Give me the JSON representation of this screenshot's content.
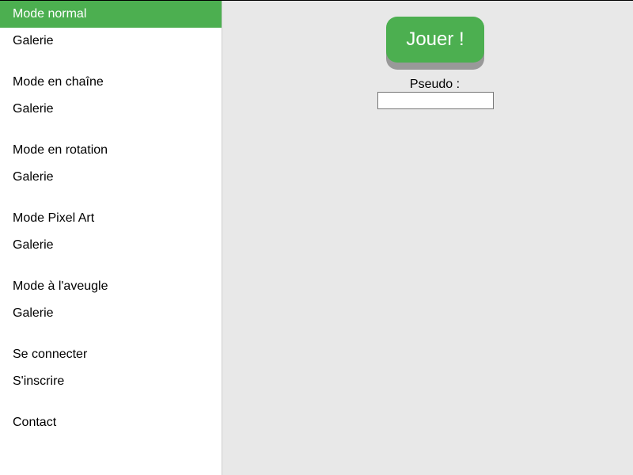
{
  "sidebar": {
    "items": [
      {
        "label": "Mode normal",
        "active": true
      },
      {
        "label": "Galerie"
      },
      {
        "label": "Mode en chaîne"
      },
      {
        "label": "Galerie"
      },
      {
        "label": "Mode en rotation"
      },
      {
        "label": "Galerie"
      },
      {
        "label": "Mode Pixel Art"
      },
      {
        "label": "Galerie"
      },
      {
        "label": "Mode à l'aveugle"
      },
      {
        "label": "Galerie"
      },
      {
        "label": "Se connecter"
      },
      {
        "label": "S'inscrire"
      },
      {
        "label": "Contact"
      }
    ]
  },
  "main": {
    "play_label": "Jouer !",
    "pseudo_label": "Pseudo :",
    "pseudo_value": "",
    "pseudo_placeholder": ""
  },
  "colors": {
    "accent": "#4caf50",
    "sidebar_bg": "#ffffff",
    "main_bg": "#e8e8e8",
    "button_shadow": "#999999"
  }
}
